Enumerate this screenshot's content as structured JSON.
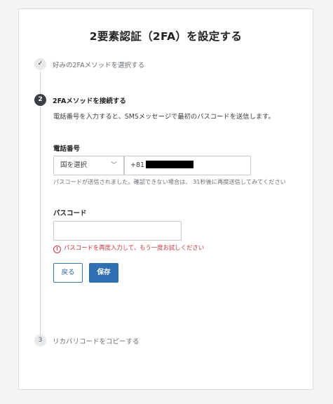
{
  "page": {
    "title": "2要素認証（2FA）を設定する"
  },
  "steps": [
    {
      "number": "1",
      "label": "好みの2FAメソッドを選択する",
      "status": "completed",
      "icon": "check-icon"
    },
    {
      "number": "2",
      "label": "2FAメソッドを接続する",
      "status": "active"
    },
    {
      "number": "3",
      "label": "リカバリコードをコピーする",
      "status": "pending"
    }
  ],
  "step2": {
    "description": "電話番号を入力すると、SMSメッセージで最初のパスコードを送信します。",
    "phone_label": "電話番号",
    "country_select": "国を選択",
    "phone_prefix": "+81",
    "hint": "パスコードが送信されました。確認できない場合は、 31秒後に再度送信してみてください",
    "passcode_label": "パスコード",
    "passcode_value": "",
    "error_text": "パスコードを再度入力して、もう一度お試しください",
    "back_label": "戻る",
    "save_label": "保存"
  },
  "colors": {
    "primary": "#2f6fb3",
    "error": "#c7343a",
    "active_step": "#3a4046"
  }
}
